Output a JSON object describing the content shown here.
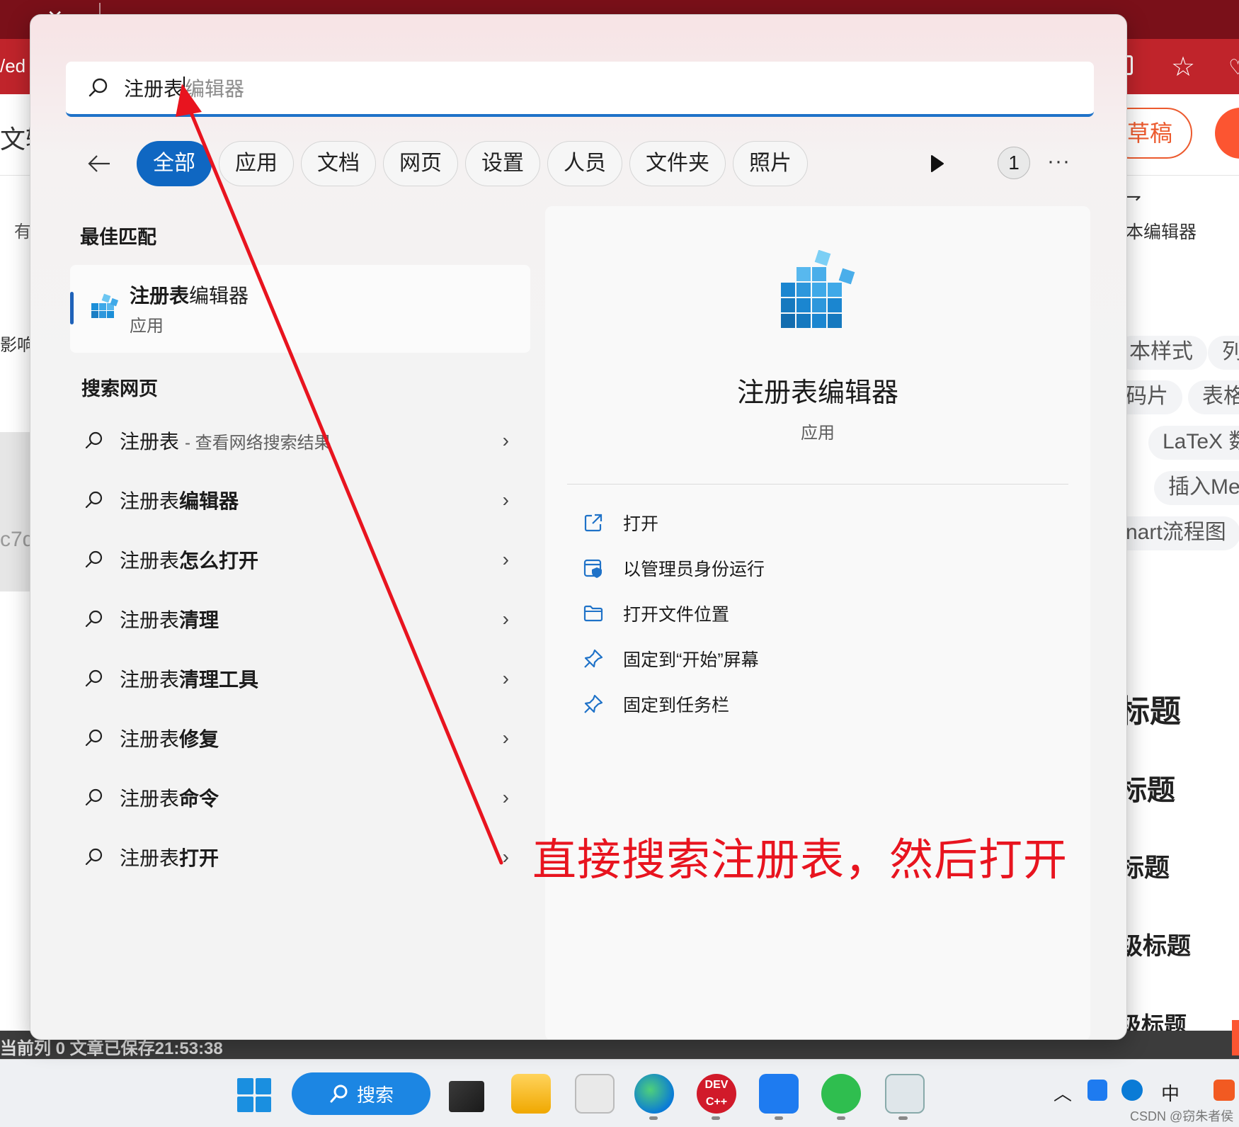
{
  "background": {
    "url_fragment": "/ed",
    "left_cut": [
      "文输",
      "有",
      "影响",
      "c7d"
    ],
    "draft_button": "草稿",
    "right_label": "本编辑器",
    "chips": [
      "本样式",
      "列",
      "码片",
      "表格",
      "LaTeX 数",
      "插入Me",
      "nart流程图"
    ],
    "headings": [
      "标题",
      "标题",
      "标题",
      "级标题",
      "级标题"
    ],
    "status_text": "当前列 0   文章已保存21:53:38"
  },
  "search": {
    "query_typed": "注册表",
    "query_suggested": "编辑器"
  },
  "filters": {
    "chips": [
      "全部",
      "应用",
      "文档",
      "网页",
      "设置",
      "人员",
      "文件夹",
      "照片"
    ],
    "active_index": 0,
    "count": "1",
    "more": "···"
  },
  "best_match": {
    "section_title": "最佳匹配",
    "name_bold": "注册表",
    "name_rest": "编辑器",
    "type": "应用"
  },
  "web_search": {
    "section_title": "搜索网页",
    "items": [
      {
        "base": "注册表",
        "bold": "",
        "sub": "- 查看网络搜索结果"
      },
      {
        "base": "注册表",
        "bold": "编辑器",
        "sub": ""
      },
      {
        "base": "注册表",
        "bold": "怎么打开",
        "sub": ""
      },
      {
        "base": "注册表",
        "bold": "清理",
        "sub": ""
      },
      {
        "base": "注册表",
        "bold": "清理工具",
        "sub": ""
      },
      {
        "base": "注册表",
        "bold": "修复",
        "sub": ""
      },
      {
        "base": "注册表",
        "bold": "命令",
        "sub": ""
      },
      {
        "base": "注册表",
        "bold": "打开",
        "sub": ""
      }
    ]
  },
  "detail": {
    "name": "注册表编辑器",
    "type": "应用",
    "actions": [
      "打开",
      "以管理员身份运行",
      "打开文件位置",
      "固定到“开始”屏幕",
      "固定到任务栏"
    ]
  },
  "annotation": {
    "text": "直接搜索注册表，然后打开",
    "color": "#e8141f"
  },
  "taskbar": {
    "search_label": "搜索",
    "ime": "中",
    "watermark": "CSDN @窃朱者侯"
  },
  "colors": {
    "accent": "#0f67c2",
    "browser_red": "#c0242b",
    "csdn_orange": "#fc5531"
  }
}
